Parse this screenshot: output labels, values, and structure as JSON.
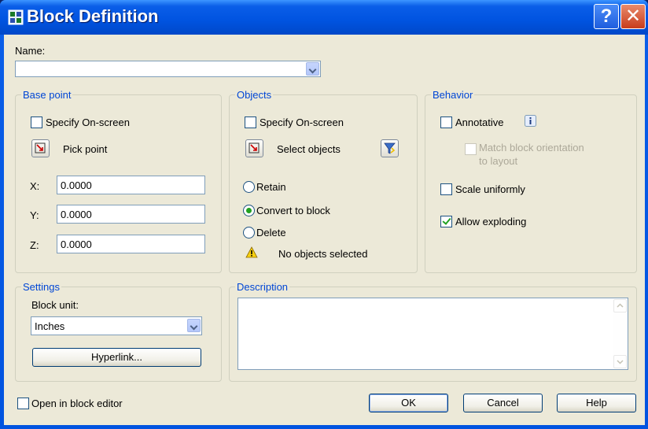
{
  "window": {
    "title": "Block Definition",
    "help_glyph": "?",
    "close_glyph": "✕"
  },
  "name": {
    "label": "Name:",
    "value": ""
  },
  "base_point": {
    "title": "Base point",
    "specify_label": "Specify On-screen",
    "specify_checked": false,
    "pick_label": "Pick point",
    "x_label": "X:",
    "x_value": "0.0000",
    "y_label": "Y:",
    "y_value": "0.0000",
    "z_label": "Z:",
    "z_value": "0.0000"
  },
  "objects": {
    "title": "Objects",
    "specify_label": "Specify On-screen",
    "specify_checked": false,
    "select_label": "Select objects",
    "retain_label": "Retain",
    "convert_label": "Convert to block",
    "delete_label": "Delete",
    "selected_option": "Convert to block",
    "status": "No objects selected"
  },
  "behavior": {
    "title": "Behavior",
    "annotative_label": "Annotative",
    "annotative_checked": false,
    "match_label_1": "Match block orientation",
    "match_label_2": "to layout",
    "scale_label": "Scale uniformly",
    "scale_checked": false,
    "explode_label": "Allow exploding",
    "explode_checked": true
  },
  "settings": {
    "title": "Settings",
    "unit_label": "Block unit:",
    "unit_value": "Inches",
    "hyperlink_label": "Hyperlink..."
  },
  "description": {
    "title": "Description",
    "value": ""
  },
  "footer": {
    "open_editor_label": "Open in block editor",
    "open_editor_checked": false,
    "ok_label": "OK",
    "cancel_label": "Cancel",
    "help_label": "Help"
  },
  "colors": {
    "titlebar": "#0053e0",
    "group_title": "#0046d5",
    "dialog_bg": "#ece9d8"
  }
}
